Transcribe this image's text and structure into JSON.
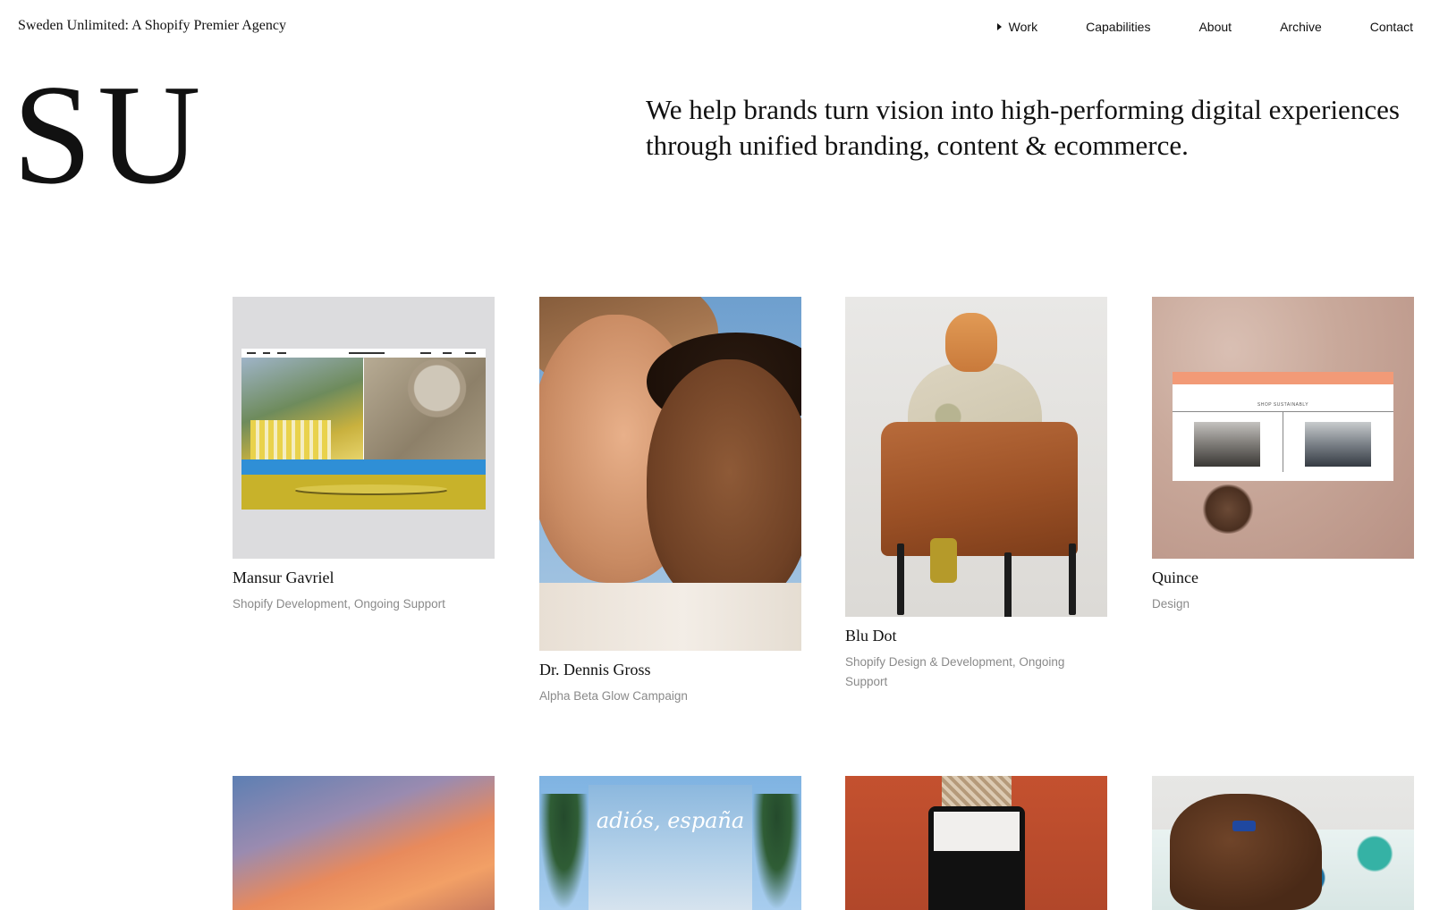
{
  "header": {
    "agency_name": "Sweden Unlimited: A Shopify Premier Agency",
    "nav": {
      "work": "Work",
      "capabilities": "Capabilities",
      "about": "About",
      "archive": "Archive",
      "contact": "Contact"
    }
  },
  "hero": {
    "logo": "SU",
    "tagline": "We help brands turn vision into high-performing digital experiences through unified branding, content & ecommerce."
  },
  "projects": [
    {
      "title": "Mansur Gavriel",
      "services": "Shopify Development, Ongoing Support"
    },
    {
      "title": "Dr. Dennis Gross",
      "services": "Alpha Beta Glow Campaign"
    },
    {
      "title": "Blu Dot",
      "services": "Shopify Design & Development, Ongoing Support"
    },
    {
      "title": "Quince",
      "services": "Design"
    }
  ],
  "thumbnails": {
    "quince_mock_title": "SHOP SUSTAINABLY",
    "adios_text": "adiós, españa"
  },
  "colors": {
    "text": "#111111",
    "muted": "#8a8a8a",
    "background": "#ffffff"
  }
}
